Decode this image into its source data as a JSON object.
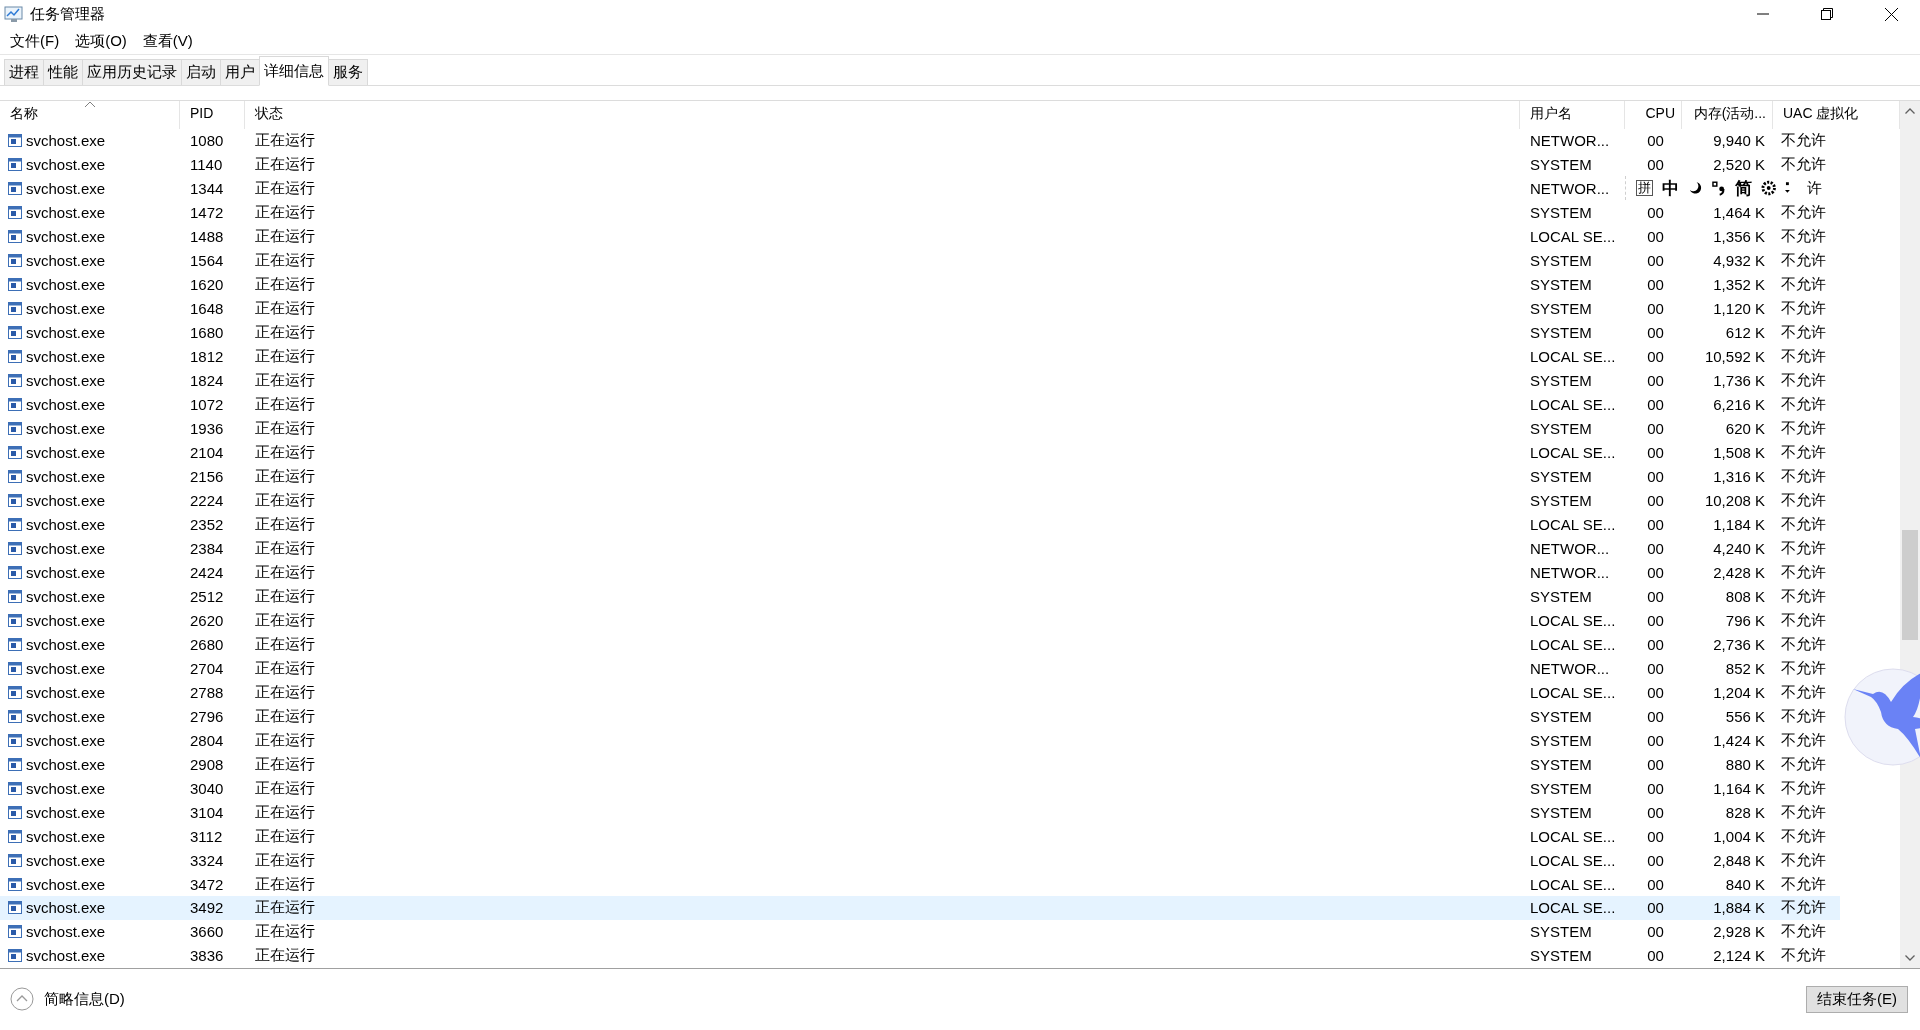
{
  "window": {
    "title": "任务管理器"
  },
  "menu": [
    "文件(F)",
    "选项(O)",
    "查看(V)"
  ],
  "tabs": [
    {
      "label": "进程",
      "selected": false
    },
    {
      "label": "性能",
      "selected": false
    },
    {
      "label": "应用历史记录",
      "selected": false
    },
    {
      "label": "启动",
      "selected": false
    },
    {
      "label": "用户",
      "selected": false
    },
    {
      "label": "详细信息",
      "selected": true
    },
    {
      "label": "服务",
      "selected": false
    }
  ],
  "table": {
    "columns": [
      "名称",
      "PID",
      "状态",
      "用户名",
      "CPU",
      "内存(活动...",
      "UAC 虚拟化"
    ],
    "rows": [
      {
        "name": "svchost.exe",
        "pid": "1080",
        "status": "正在运行",
        "user": "NETWOR...",
        "cpu": "00",
        "memory": "9,940 K",
        "uac": "不允许",
        "selected": false
      },
      {
        "name": "svchost.exe",
        "pid": "1140",
        "status": "正在运行",
        "user": "SYSTEM",
        "cpu": "00",
        "memory": "2,520 K",
        "uac": "不允许",
        "selected": false
      },
      {
        "name": "svchost.exe",
        "pid": "1344",
        "status": "正在运行",
        "user": "NETWOR...",
        "uac": "许",
        "selected": false
      },
      {
        "name": "svchost.exe",
        "pid": "1472",
        "status": "正在运行",
        "user": "SYSTEM",
        "cpu": "00",
        "memory": "1,464 K",
        "uac": "不允许",
        "selected": false
      },
      {
        "name": "svchost.exe",
        "pid": "1488",
        "status": "正在运行",
        "user": "LOCAL SE...",
        "cpu": "00",
        "memory": "1,356 K",
        "uac": "不允许",
        "selected": false
      },
      {
        "name": "svchost.exe",
        "pid": "1564",
        "status": "正在运行",
        "user": "SYSTEM",
        "cpu": "00",
        "memory": "4,932 K",
        "uac": "不允许",
        "selected": false
      },
      {
        "name": "svchost.exe",
        "pid": "1620",
        "status": "正在运行",
        "user": "SYSTEM",
        "cpu": "00",
        "memory": "1,352 K",
        "uac": "不允许",
        "selected": false
      },
      {
        "name": "svchost.exe",
        "pid": "1648",
        "status": "正在运行",
        "user": "SYSTEM",
        "cpu": "00",
        "memory": "1,120 K",
        "uac": "不允许",
        "selected": false
      },
      {
        "name": "svchost.exe",
        "pid": "1680",
        "status": "正在运行",
        "user": "SYSTEM",
        "cpu": "00",
        "memory": "612 K",
        "uac": "不允许",
        "selected": false
      },
      {
        "name": "svchost.exe",
        "pid": "1812",
        "status": "正在运行",
        "user": "LOCAL SE...",
        "cpu": "00",
        "memory": "10,592 K",
        "uac": "不允许",
        "selected": false
      },
      {
        "name": "svchost.exe",
        "pid": "1824",
        "status": "正在运行",
        "user": "SYSTEM",
        "cpu": "00",
        "memory": "1,736 K",
        "uac": "不允许",
        "selected": false
      },
      {
        "name": "svchost.exe",
        "pid": "1072",
        "status": "正在运行",
        "user": "LOCAL SE...",
        "cpu": "00",
        "memory": "6,216 K",
        "uac": "不允许",
        "selected": false
      },
      {
        "name": "svchost.exe",
        "pid": "1936",
        "status": "正在运行",
        "user": "SYSTEM",
        "cpu": "00",
        "memory": "620 K",
        "uac": "不允许",
        "selected": false
      },
      {
        "name": "svchost.exe",
        "pid": "2104",
        "status": "正在运行",
        "user": "LOCAL SE...",
        "cpu": "00",
        "memory": "1,508 K",
        "uac": "不允许",
        "selected": false
      },
      {
        "name": "svchost.exe",
        "pid": "2156",
        "status": "正在运行",
        "user": "SYSTEM",
        "cpu": "00",
        "memory": "1,316 K",
        "uac": "不允许",
        "selected": false
      },
      {
        "name": "svchost.exe",
        "pid": "2224",
        "status": "正在运行",
        "user": "SYSTEM",
        "cpu": "00",
        "memory": "10,208 K",
        "uac": "不允许",
        "selected": false
      },
      {
        "name": "svchost.exe",
        "pid": "2352",
        "status": "正在运行",
        "user": "LOCAL SE...",
        "cpu": "00",
        "memory": "1,184 K",
        "uac": "不允许",
        "selected": false
      },
      {
        "name": "svchost.exe",
        "pid": "2384",
        "status": "正在运行",
        "user": "NETWOR...",
        "cpu": "00",
        "memory": "4,240 K",
        "uac": "不允许",
        "selected": false
      },
      {
        "name": "svchost.exe",
        "pid": "2424",
        "status": "正在运行",
        "user": "NETWOR...",
        "cpu": "00",
        "memory": "2,428 K",
        "uac": "不允许",
        "selected": false
      },
      {
        "name": "svchost.exe",
        "pid": "2512",
        "status": "正在运行",
        "user": "SYSTEM",
        "cpu": "00",
        "memory": "808 K",
        "uac": "不允许",
        "selected": false
      },
      {
        "name": "svchost.exe",
        "pid": "2620",
        "status": "正在运行",
        "user": "LOCAL SE...",
        "cpu": "00",
        "memory": "796 K",
        "uac": "不允许",
        "selected": false
      },
      {
        "name": "svchost.exe",
        "pid": "2680",
        "status": "正在运行",
        "user": "LOCAL SE...",
        "cpu": "00",
        "memory": "2,736 K",
        "uac": "不允许",
        "selected": false
      },
      {
        "name": "svchost.exe",
        "pid": "2704",
        "status": "正在运行",
        "user": "NETWOR...",
        "cpu": "00",
        "memory": "852 K",
        "uac": "不允许",
        "selected": false
      },
      {
        "name": "svchost.exe",
        "pid": "2788",
        "status": "正在运行",
        "user": "LOCAL SE...",
        "cpu": "00",
        "memory": "1,204 K",
        "uac": "不允许",
        "selected": false
      },
      {
        "name": "svchost.exe",
        "pid": "2796",
        "status": "正在运行",
        "user": "SYSTEM",
        "cpu": "00",
        "memory": "556 K",
        "uac": "不允许",
        "selected": false
      },
      {
        "name": "svchost.exe",
        "pid": "2804",
        "status": "正在运行",
        "user": "SYSTEM",
        "cpu": "00",
        "memory": "1,424 K",
        "uac": "不允许",
        "selected": false
      },
      {
        "name": "svchost.exe",
        "pid": "2908",
        "status": "正在运行",
        "user": "SYSTEM",
        "cpu": "00",
        "memory": "880 K",
        "uac": "不允许",
        "selected": false
      },
      {
        "name": "svchost.exe",
        "pid": "3040",
        "status": "正在运行",
        "user": "SYSTEM",
        "cpu": "00",
        "memory": "1,164 K",
        "uac": "不允许",
        "selected": false
      },
      {
        "name": "svchost.exe",
        "pid": "3104",
        "status": "正在运行",
        "user": "SYSTEM",
        "cpu": "00",
        "memory": "828 K",
        "uac": "不允许",
        "selected": false
      },
      {
        "name": "svchost.exe",
        "pid": "3112",
        "status": "正在运行",
        "user": "LOCAL SE...",
        "cpu": "00",
        "memory": "1,004 K",
        "uac": "不允许",
        "selected": false
      },
      {
        "name": "svchost.exe",
        "pid": "3324",
        "status": "正在运行",
        "user": "LOCAL SE...",
        "cpu": "00",
        "memory": "2,848 K",
        "uac": "不允许",
        "selected": false
      },
      {
        "name": "svchost.exe",
        "pid": "3472",
        "status": "正在运行",
        "user": "LOCAL SE...",
        "cpu": "00",
        "memory": "840 K",
        "uac": "不允许",
        "selected": false
      },
      {
        "name": "svchost.exe",
        "pid": "3492",
        "status": "正在运行",
        "user": "LOCAL SE...",
        "cpu": "00",
        "memory": "1,884 K",
        "uac": "不允许",
        "selected": true
      },
      {
        "name": "svchost.exe",
        "pid": "3660",
        "status": "正在运行",
        "user": "SYSTEM",
        "cpu": "00",
        "memory": "2,928 K",
        "uac": "不允许",
        "selected": false
      },
      {
        "name": "svchost.exe",
        "pid": "3836",
        "status": "正在运行",
        "user": "SYSTEM",
        "cpu": "00",
        "memory": "2,124 K",
        "uac": "不允许",
        "selected": false
      }
    ]
  },
  "ime_toolbar": {
    "mode": "拼",
    "language": "中",
    "script": "简"
  },
  "footer": {
    "details_toggle": "简略信息(D)",
    "end_task": "结束任务(E)"
  }
}
